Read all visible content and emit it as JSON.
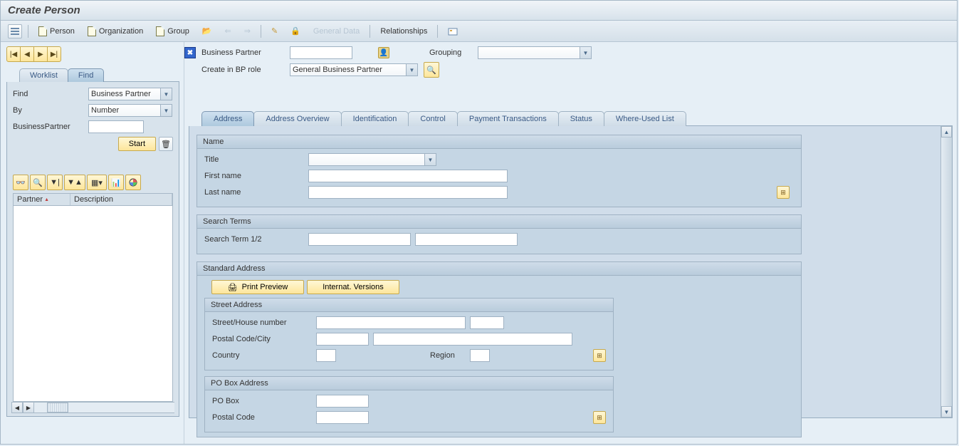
{
  "title": "Create Person",
  "menu": {
    "person": "Person",
    "organization": "Organization",
    "group": "Group",
    "general_data": "General Data",
    "relationships": "Relationships"
  },
  "left": {
    "tabs": {
      "worklist": "Worklist",
      "find": "Find"
    },
    "find_label": "Find",
    "find_value": "Business Partner",
    "by_label": "By",
    "by_value": "Number",
    "bp_label": "BusinessPartner",
    "bp_value": "",
    "start": "Start",
    "grid": {
      "partner": "Partner",
      "description": "Description"
    }
  },
  "right": {
    "bp_label": "Business Partner",
    "bp_value": "",
    "grouping_label": "Grouping",
    "grouping_value": "",
    "create_role_label": "Create in BP role",
    "create_role_value": "General Business Partner",
    "tabs": {
      "address": "Address",
      "overview": "Address Overview",
      "identification": "Identification",
      "control": "Control",
      "payment": "Payment Transactions",
      "status": "Status",
      "where": "Where-Used List"
    },
    "name_panel": {
      "title": "Name",
      "title_label": "Title",
      "title_value": "",
      "first_name_label": "First name",
      "first_name_value": "",
      "last_name_label": "Last name",
      "last_name_value": ""
    },
    "search_panel": {
      "title": "Search Terms",
      "term_label": "Search Term 1/2",
      "term1": "",
      "term2": ""
    },
    "addr_panel": {
      "title": "Standard Address",
      "print_preview": "Print Preview",
      "intl_versions": "Internat. Versions",
      "street_title": "Street Address",
      "street_label": "Street/House number",
      "street_value": "",
      "house_value": "",
      "postal_label": "Postal Code/City",
      "postal_value": "",
      "city_value": "",
      "country_label": "Country",
      "country_value": "",
      "region_label": "Region",
      "region_value": "",
      "pobox_title": "PO Box Address",
      "pobox_label": "PO Box",
      "pobox_value": "",
      "pobox_postal_label": "Postal Code",
      "pobox_postal_value": ""
    }
  }
}
